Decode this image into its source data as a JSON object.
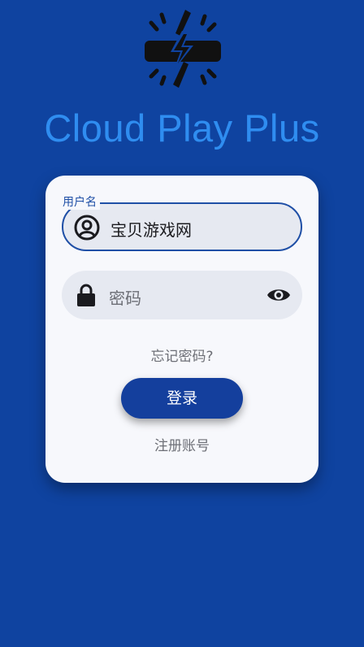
{
  "app": {
    "title": "Cloud Play Plus",
    "logo_icon": "lightning-controller-logo"
  },
  "login_form": {
    "username": {
      "label": "用户名",
      "value": "宝贝游戏网",
      "icon": "account-circle-icon"
    },
    "password": {
      "placeholder": "密码",
      "icon": "lock-icon",
      "toggle_icon": "eye-icon"
    },
    "forgot_password": "忘记密码?",
    "login_button": "登录",
    "register_link": "注册账号"
  },
  "colors": {
    "background": "#0f43a0",
    "title": "#2f8df0",
    "card": "#f7f8fc",
    "field_fill": "#e6e9f1",
    "accent": "#1f4fa6",
    "button": "#143f9d",
    "muted_text": "#6d6f76"
  }
}
